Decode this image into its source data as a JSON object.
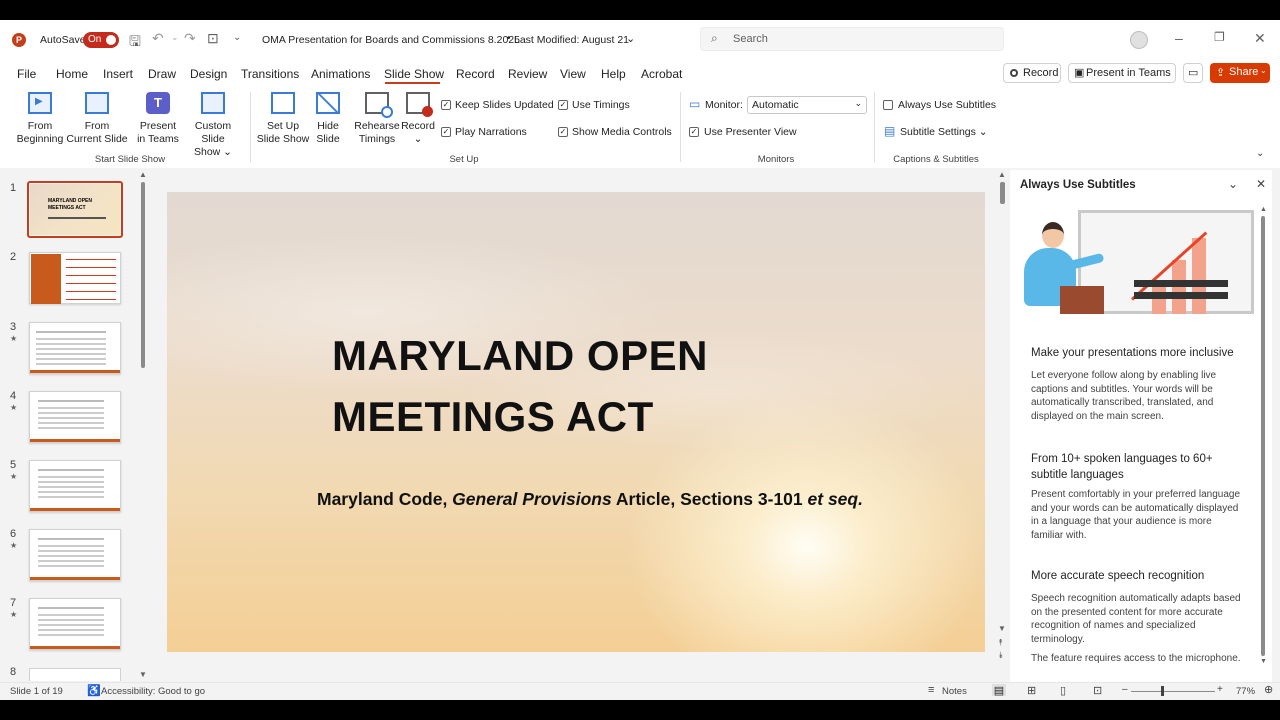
{
  "titlebar": {
    "autosave_label": "AutoSave",
    "autosave_toggle": "On",
    "doc_title": "OMA Presentation for Boards and Commissions 8.2025",
    "modified": "Last Modified: August 21",
    "search_placeholder": "Search"
  },
  "menu": {
    "tabs": [
      "File",
      "Home",
      "Insert",
      "Draw",
      "Design",
      "Transitions",
      "Animations",
      "Slide Show",
      "Record",
      "Review",
      "View",
      "Help",
      "Acrobat"
    ],
    "active": "Slide Show",
    "record_btn": "Record",
    "present_teams_btn": "Present in Teams",
    "share_btn": "Share"
  },
  "ribbon": {
    "from_beginning": [
      "From",
      "Beginning"
    ],
    "from_current": [
      "From",
      "Current Slide"
    ],
    "present_teams": [
      "Present",
      "in Teams"
    ],
    "custom_show": [
      "Custom Slide",
      "Show ⌄"
    ],
    "group_start": "Start Slide Show",
    "setup_show": [
      "Set Up",
      "Slide Show"
    ],
    "hide_slide": [
      "Hide",
      "Slide"
    ],
    "rehearse": [
      "Rehearse",
      "Timings"
    ],
    "record": [
      "Record",
      "⌄"
    ],
    "keep_updated": "Keep Slides Updated",
    "play_narrations": "Play Narrations",
    "use_timings": "Use Timings",
    "show_media": "Show Media Controls",
    "group_setup": "Set Up",
    "monitor_label": "Monitor:",
    "monitor_value": "Automatic",
    "presenter_view": "Use Presenter View",
    "group_monitors": "Monitors",
    "always_subtitles": "Always Use Subtitles",
    "subtitle_settings": "Subtitle Settings ⌄",
    "group_captions": "Captions & Subtitles"
  },
  "thumbnails": [
    "1",
    "2",
    "3",
    "4",
    "5",
    "6",
    "7",
    "8"
  ],
  "thumb1_title": [
    "MARYLAND OPEN",
    "MEETINGS ACT"
  ],
  "slide": {
    "title_line1": "MARYLAND OPEN",
    "title_line2": "MEETINGS ACT",
    "sub_a": "Maryland Code, ",
    "sub_b": "General Provisions",
    "sub_c": " Article, Sections 3-101 ",
    "sub_d": "et seq."
  },
  "panel": {
    "title": "Always Use Subtitles",
    "h1": "Make your presentations more inclusive",
    "p1": "Let everyone follow along by enabling live captions and subtitles. Your words will be automatically transcribed, translated, and displayed on the main screen.",
    "h2": "From 10+ spoken languages to 60+ subtitle languages",
    "p2": "Present comfortably in your preferred language and your words can be automatically displayed in a language that your audience is more familiar with.",
    "h3": "More accurate speech recognition",
    "p3": "Speech recognition automatically adapts based on the presented content for more accurate recognition of names and specialized terminology.",
    "p4": "The feature requires access to the microphone."
  },
  "status": {
    "slide_of": "Slide 1 of 19",
    "accessibility": "Accessibility: Good to go",
    "notes": "Notes",
    "zoom": "77%"
  },
  "colors": {
    "accent": "#c43e1c",
    "share": "#d83b01",
    "toggle": "#c42b1c"
  }
}
